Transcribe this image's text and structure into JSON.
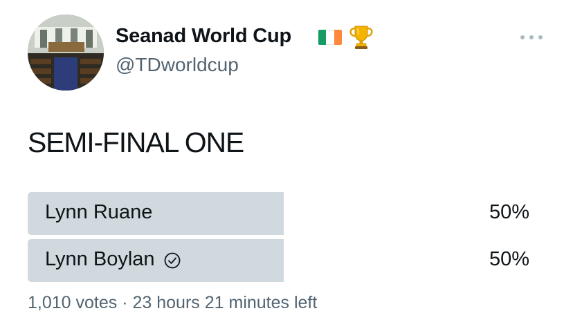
{
  "author": {
    "display_name": "Seanad World Cup",
    "handle": "@TDworldcup",
    "name_emojis": [
      "ireland-flag-icon",
      "trophy-icon"
    ],
    "avatar": "seanad-chamber-avatar"
  },
  "menu": {
    "icon": "more-options-icon"
  },
  "tweet": {
    "text": "SEMI-FINAL ONE"
  },
  "poll": {
    "options": [
      {
        "label": "Lynn Ruane",
        "percent": "50%",
        "share": 0.5,
        "selected": false
      },
      {
        "label": "Lynn Boylan",
        "percent": "50%",
        "share": 0.5,
        "selected": true,
        "selected_icon": "check-circle-icon"
      }
    ],
    "votes": "1,010 votes",
    "separator": "·",
    "time_left": "23 hours 21 minutes left"
  },
  "colors": {
    "bar": "#cfd9de",
    "secondary_text": "#536471",
    "flag_green": "#169b62",
    "flag_white": "#ffffff",
    "flag_orange": "#ff883e"
  }
}
